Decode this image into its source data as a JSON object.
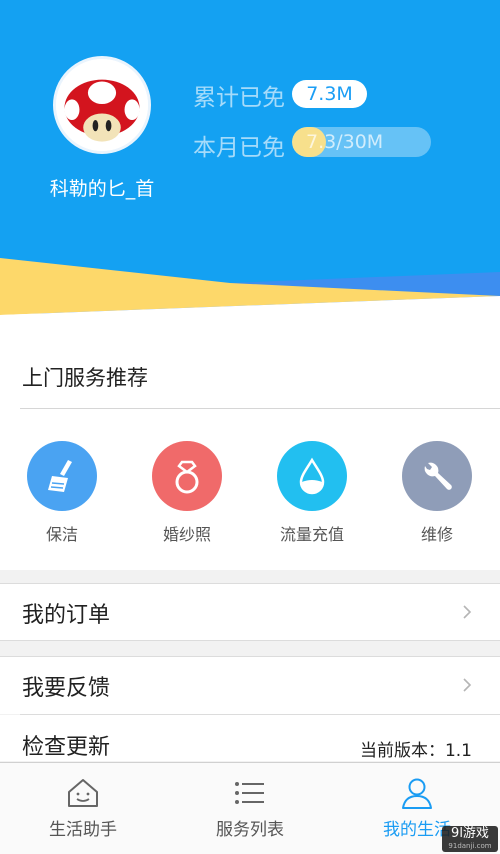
{
  "profile": {
    "username": "科勒的匕_首",
    "total_saved_label": "累计已免",
    "total_saved_value": "7.3M",
    "month_saved_label": "本月已免",
    "month_saved_value": "7.3/30M",
    "month_progress": 0.243
  },
  "services": {
    "title": "上门服务推荐",
    "items": [
      {
        "label": "保洁",
        "icon": "broom-icon",
        "color": "#4aa3f2"
      },
      {
        "label": "婚纱照",
        "icon": "ring-icon",
        "color": "#f06a6a"
      },
      {
        "label": "流量充值",
        "icon": "water-drop-icon",
        "color": "#22bff0"
      },
      {
        "label": "维修",
        "icon": "wrench-icon",
        "color": "#8f9db8"
      }
    ]
  },
  "menu": {
    "orders_label": "我的订单",
    "feedback_label": "我要反馈",
    "update_label": "检查更新",
    "version_text": "当前版本：1.1"
  },
  "tabs": [
    {
      "label": "生活助手",
      "icon": "home-smile-icon",
      "active": false
    },
    {
      "label": "服务列表",
      "icon": "list-icon",
      "active": false
    },
    {
      "label": "我的生活",
      "icon": "person-icon",
      "active": true
    }
  ],
  "watermark": {
    "text": "9l游戏",
    "sub": "91danji.com"
  },
  "colors": {
    "primary": "#1a9cf3",
    "header_blue": "#14a1f2",
    "accent_yellow": "#fdd86a"
  }
}
